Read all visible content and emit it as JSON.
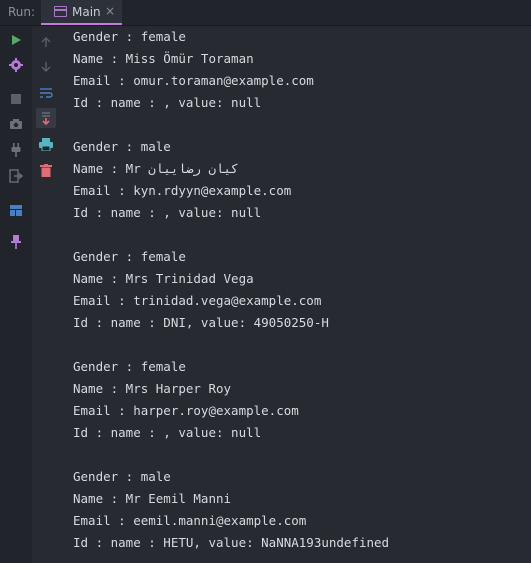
{
  "tabbar": {
    "run_label": "Run:",
    "tab_label": "Main",
    "tab_close": "×"
  },
  "icons": {
    "run": "play-icon",
    "settings": "gear-icon",
    "stop": "stop-icon",
    "camera": "camera-icon",
    "plug": "plug-icon",
    "exit": "exit-icon",
    "layout": "layout-icon",
    "pin": "pin-icon",
    "up": "arrow-up-icon",
    "down": "arrow-down-icon",
    "wrap": "soft-wrap-icon",
    "scroll": "scroll-to-end-icon",
    "print": "print-icon",
    "trash": "trash-icon"
  },
  "console": {
    "entries": [
      {
        "gender": "Gender : female",
        "name": "Name : Miss Ömür Toraman",
        "email": "Email : omur.toraman@example.com",
        "id": "Id : name : , value: null"
      },
      {
        "gender": "Gender : male",
        "name": "Name : Mr کیان رضاییان",
        "email": "Email : kyn.rdyyn@example.com",
        "id": "Id : name : , value: null"
      },
      {
        "gender": "Gender : female",
        "name": "Name : Mrs Trinidad Vega",
        "email": "Email : trinidad.vega@example.com",
        "id": "Id : name : DNI, value: 49050250-H"
      },
      {
        "gender": "Gender : female",
        "name": "Name : Mrs Harper Roy",
        "email": "Email : harper.roy@example.com",
        "id": "Id : name : , value: null"
      },
      {
        "gender": "Gender : male",
        "name": "Name : Mr Eemil Manni",
        "email": "Email : eemil.manni@example.com",
        "id": "Id : name : HETU, value: NaNNA193undefined"
      }
    ]
  }
}
